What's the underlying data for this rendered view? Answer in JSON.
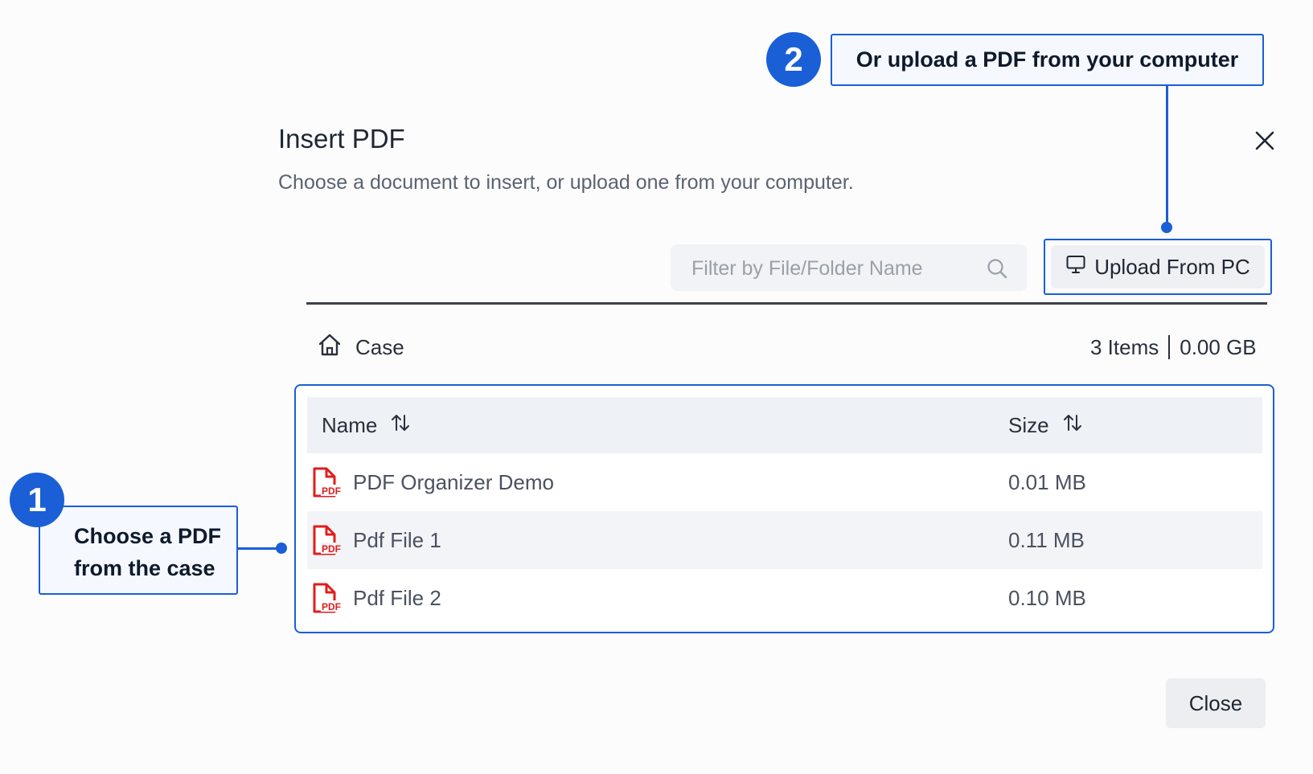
{
  "callouts": {
    "step1": {
      "number": "1",
      "line1": "Choose a PDF",
      "line2": "from the case"
    },
    "step2": {
      "number": "2",
      "text": "Or upload a PDF from your computer"
    }
  },
  "dialog": {
    "title": "Insert PDF",
    "subtitle": "Choose a document to insert, or upload one from your computer.",
    "close_icon": "close-icon"
  },
  "filter": {
    "placeholder": "Filter by File/Folder Name",
    "value": "",
    "icon": "search-icon"
  },
  "upload": {
    "label": "Upload From PC",
    "icon": "monitor-icon"
  },
  "breadcrumb": {
    "icon": "home-icon",
    "label": "Case"
  },
  "stats": {
    "items": "3 Items",
    "size": "0.00 GB"
  },
  "table": {
    "columns": [
      {
        "label": "Name",
        "sort_icon": "sort-icon"
      },
      {
        "label": "Size",
        "sort_icon": "sort-icon"
      }
    ],
    "rows": [
      {
        "name": "PDF Organizer Demo",
        "size": "0.01 MB",
        "icon": "pdf-file-icon"
      },
      {
        "name": "Pdf File 1",
        "size": "0.11 MB",
        "icon": "pdf-file-icon"
      },
      {
        "name": "Pdf File 2",
        "size": "0.10 MB",
        "icon": "pdf-file-icon"
      }
    ]
  },
  "footer": {
    "close_label": "Close"
  },
  "colors": {
    "accent": "#1a5fd6",
    "pdf_red": "#e11d1d"
  }
}
